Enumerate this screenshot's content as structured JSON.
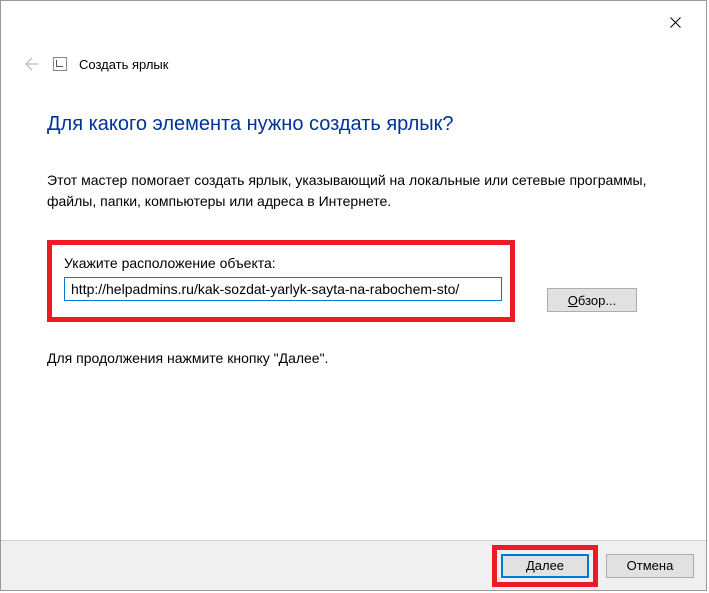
{
  "titlebar": {
    "dialog_title": "Создать ярлык"
  },
  "content": {
    "heading": "Для какого элемента нужно создать ярлык?",
    "description": "Этот мастер помогает создать ярлык, указывающий на локальные или сетевые программы, файлы, папки, компьютеры или адреса в Интернете.",
    "input_label": "Укажите расположение объекта:",
    "location_value": "http://helpadmins.ru/kak-sozdat-yarlyk-sayta-na-rabochem-sto/",
    "browse_label": "Обзор...",
    "continue_text": "Для продолжения нажмите кнопку \"Далее\"."
  },
  "footer": {
    "next_label": "Далее",
    "cancel_label": "Отмена"
  }
}
